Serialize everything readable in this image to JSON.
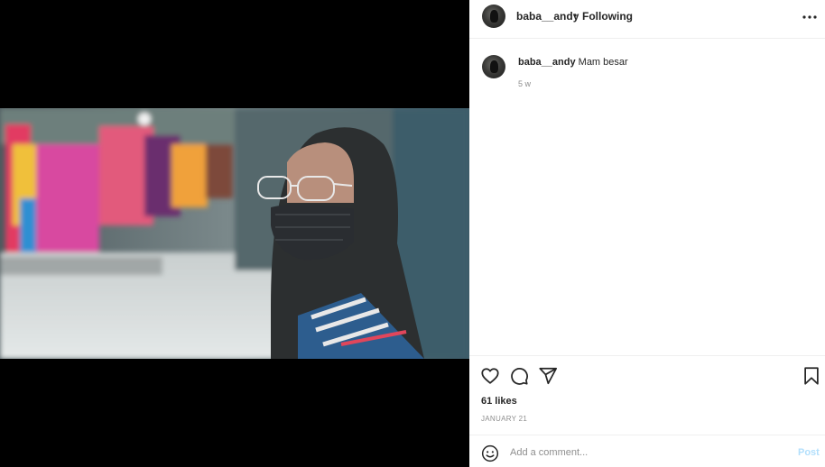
{
  "post": {
    "author": "baba__andy",
    "separator": "•",
    "follow_status": "Following",
    "more_icon": "more-horizontal-icon"
  },
  "caption": {
    "author": "baba__andy",
    "text": "Mam besar",
    "age": "5 w"
  },
  "actions": {
    "icons": [
      "heart-icon",
      "comment-bubble-icon",
      "share-paper-plane-icon",
      "bookmark-icon"
    ],
    "likes": "61 likes",
    "date": "JANUARY 21"
  },
  "add_comment": {
    "emoji_icon": "emoji-smiley-icon",
    "placeholder": "Add a comment...",
    "post_label": "Post",
    "post_color": "#b2dffc"
  },
  "colors": {
    "media_background": "#000000",
    "divider": "#efefef",
    "secondary_text": "#8e8e8e"
  }
}
